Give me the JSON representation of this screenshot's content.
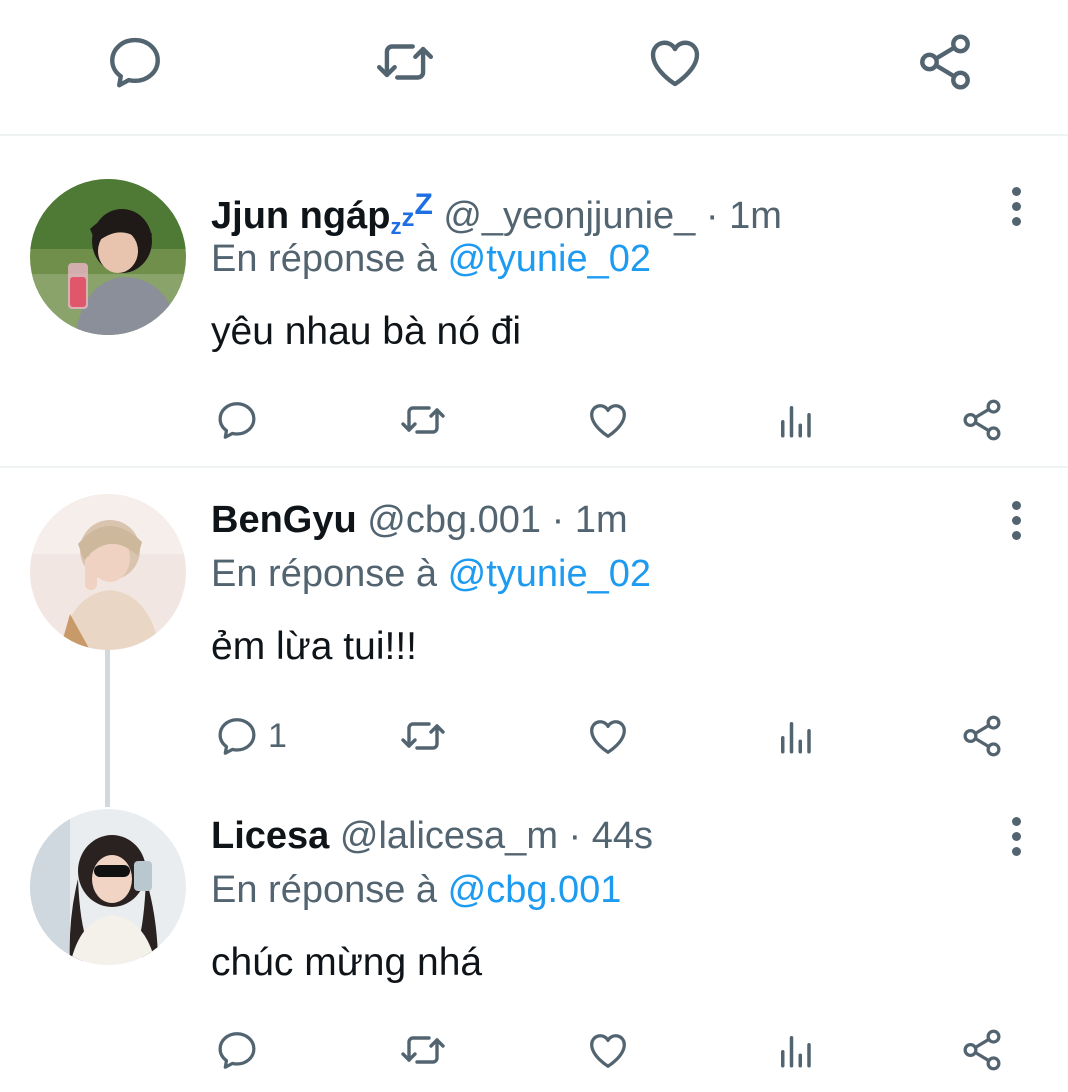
{
  "top_actions": {
    "icons": [
      "reply-icon",
      "retweet-icon",
      "like-icon",
      "share-icon"
    ]
  },
  "colors": {
    "text": "#0f1419",
    "secondary": "#536471",
    "link": "#1d9bf0",
    "separator": "#eff3f4",
    "thread_line": "#cfd9de"
  },
  "tweets": [
    {
      "name": "Jjun ngáp",
      "name_emoji": "zzz",
      "handle": "@_yeonjjunie_",
      "separator": "·",
      "time": "1m",
      "reply_prefix": "En réponse à",
      "reply_to": "@tyunie_02",
      "text": "yêu nhau bà nó đi",
      "reply_count": ""
    },
    {
      "name": "BenGyu",
      "handle": "@cbg.001",
      "separator": "·",
      "time": "1m",
      "reply_prefix": "En réponse à",
      "reply_to": "@tyunie_02",
      "text": "ẻm lừa tui!!!",
      "reply_count": "1"
    },
    {
      "name": "Licesa",
      "handle": "@lalicesa_m",
      "separator": "·",
      "time": "44s",
      "reply_prefix": "En réponse à",
      "reply_to": "@cbg.001",
      "text": "chúc mừng nhá",
      "reply_count": ""
    }
  ]
}
